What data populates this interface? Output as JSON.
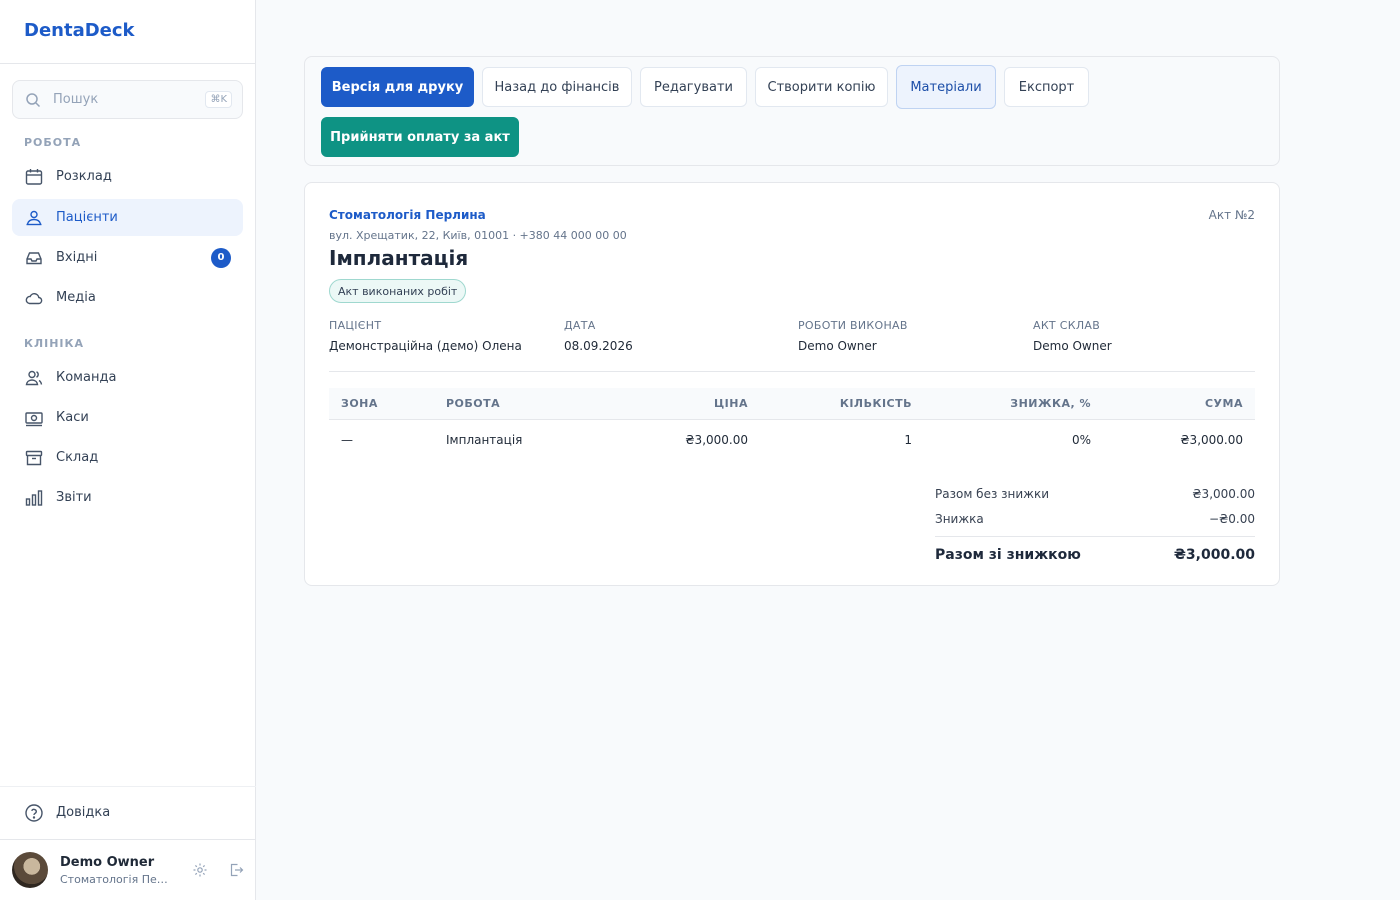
{
  "app": {
    "brand": "DentaDeck"
  },
  "search": {
    "placeholder": "Пошук",
    "shortcut": "⌘K"
  },
  "sidebar": {
    "sections": [
      {
        "label": "РОБОТА"
      },
      {
        "label": "КЛІНІКА"
      }
    ],
    "items": [
      {
        "label": "Розклад",
        "icon": "calendar-icon"
      },
      {
        "label": "Пацієнти",
        "icon": "patients-icon",
        "active": true
      },
      {
        "label": "Вхідні",
        "icon": "inbox-icon",
        "badge": "0"
      },
      {
        "label": "Медіа",
        "icon": "cloud-icon"
      },
      {
        "label": "Команда",
        "icon": "team-icon"
      },
      {
        "label": "Каси",
        "icon": "cash-icon"
      },
      {
        "label": "Склад",
        "icon": "archive-icon"
      },
      {
        "label": "Звіти",
        "icon": "chart-icon"
      }
    ],
    "help": "Довідка",
    "user": {
      "name": "Demo Owner",
      "org": "Стоматологія Перлина"
    }
  },
  "toolbar": {
    "print": "Версія для друку",
    "back": "Назад до фінансів",
    "edit": "Редагувати",
    "copy": "Створити копію",
    "materials": "Матеріали",
    "export": "Експорт",
    "accept_payment": "Прийняти оплату за акт"
  },
  "document": {
    "clinic_name": "Стоматологія Перлина",
    "clinic_address": "вул. Хрещатик, 22, Київ, 01001 · +380 44 000 00 00",
    "act_number": "Акт №2",
    "title": "Імплантація",
    "badge": "Акт виконаних робіт",
    "meta": [
      {
        "label": "ПАЦІЄНТ",
        "value": "Демонстраційна (демо) Олена"
      },
      {
        "label": "ДАТА",
        "value": "08.09.2026"
      },
      {
        "label": "РОБОТИ ВИКОНАВ",
        "value": "Demo Owner"
      },
      {
        "label": "АКТ СКЛАВ",
        "value": "Demo Owner"
      }
    ],
    "table": {
      "headers": [
        "ЗОНА",
        "РОБОТА",
        "ЦІНА",
        "КІЛЬКІСТЬ",
        "ЗНИЖКА, %",
        "СУМА"
      ],
      "rows": [
        [
          "—",
          "Імплантація",
          "₴3,000.00",
          "1",
          "0%",
          "₴3,000.00"
        ]
      ]
    },
    "totals": {
      "subtotal_label": "Разом без знижки",
      "subtotal": "₴3,000.00",
      "discount_label": "Знижка",
      "discount": "−₴0.00",
      "total_label": "Разом зі знижкою",
      "total": "₴3,000.00"
    }
  },
  "colors": {
    "accent": "#1d5bc8",
    "teal": "#0e9384"
  }
}
